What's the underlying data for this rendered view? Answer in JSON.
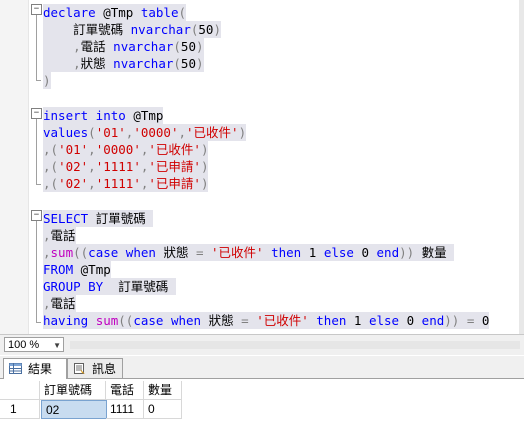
{
  "editor": {
    "lines": [
      [
        [
          "kw",
          "declare "
        ],
        [
          "id",
          "@Tmp "
        ],
        [
          "kw",
          "table"
        ],
        [
          "op",
          "("
        ]
      ],
      [
        [
          "id",
          "    訂單號碼 "
        ],
        [
          "kw",
          "nvarchar"
        ],
        [
          "op",
          "("
        ],
        [
          "lit",
          "50"
        ],
        [
          "op",
          ")"
        ]
      ],
      [
        [
          "op",
          "    ,"
        ],
        [
          "id",
          "電話 "
        ],
        [
          "kw",
          "nvarchar"
        ],
        [
          "op",
          "("
        ],
        [
          "lit",
          "50"
        ],
        [
          "op",
          ")"
        ]
      ],
      [
        [
          "op",
          "    ,"
        ],
        [
          "id",
          "狀態 "
        ],
        [
          "kw",
          "nvarchar"
        ],
        [
          "op",
          "("
        ],
        [
          "lit",
          "50"
        ],
        [
          "op",
          ")"
        ]
      ],
      [
        [
          "op",
          ")"
        ]
      ],
      [],
      [
        [
          "kw",
          "insert into "
        ],
        [
          "id",
          "@Tmp"
        ]
      ],
      [
        [
          "kw",
          "values"
        ],
        [
          "op",
          "("
        ],
        [
          "str",
          "'01'"
        ],
        [
          "op",
          ","
        ],
        [
          "str",
          "'0000'"
        ],
        [
          "op",
          ","
        ],
        [
          "str",
          "'已收件'"
        ],
        [
          "op",
          ")"
        ]
      ],
      [
        [
          "op",
          ",("
        ],
        [
          "str",
          "'01'"
        ],
        [
          "op",
          ","
        ],
        [
          "str",
          "'0000'"
        ],
        [
          "op",
          ","
        ],
        [
          "str",
          "'已收件'"
        ],
        [
          "op",
          ")"
        ]
      ],
      [
        [
          "op",
          ",("
        ],
        [
          "str",
          "'02'"
        ],
        [
          "op",
          ","
        ],
        [
          "str",
          "'1111'"
        ],
        [
          "op",
          ","
        ],
        [
          "str",
          "'已申請'"
        ],
        [
          "op",
          ")"
        ]
      ],
      [
        [
          "op",
          ",("
        ],
        [
          "str",
          "'02'"
        ],
        [
          "op",
          ","
        ],
        [
          "str",
          "'1111'"
        ],
        [
          "op",
          ","
        ],
        [
          "str",
          "'已申請'"
        ],
        [
          "op",
          ")"
        ]
      ],
      [],
      [
        [
          "kw",
          "SELECT "
        ],
        [
          "id",
          "訂單號碼 "
        ]
      ],
      [
        [
          "op",
          ","
        ],
        [
          "id",
          "電話"
        ]
      ],
      [
        [
          "op",
          ","
        ],
        [
          "fn",
          "sum"
        ],
        [
          "op",
          "(("
        ],
        [
          "kw",
          "case when "
        ],
        [
          "id",
          "狀態 "
        ],
        [
          "op",
          "= "
        ],
        [
          "str",
          "'已收件' "
        ],
        [
          "kw",
          "then "
        ],
        [
          "lit",
          "1 "
        ],
        [
          "kw",
          "else "
        ],
        [
          "lit",
          "0 "
        ],
        [
          "kw",
          "end"
        ],
        [
          "op",
          "))"
        ],
        [
          "id",
          " 數量 "
        ]
      ],
      [
        [
          "kw",
          "FROM "
        ],
        [
          "id",
          "@Tmp"
        ]
      ],
      [
        [
          "kw",
          "GROUP BY  "
        ],
        [
          "id",
          "訂單號碼 "
        ]
      ],
      [
        [
          "op",
          ","
        ],
        [
          "id",
          "電話"
        ]
      ],
      [
        [
          "kw",
          "having "
        ],
        [
          "fn",
          "sum"
        ],
        [
          "op",
          "(("
        ],
        [
          "kw",
          "case when "
        ],
        [
          "id",
          "狀態 "
        ],
        [
          "op",
          "= "
        ],
        [
          "str",
          "'已收件' "
        ],
        [
          "kw",
          "then "
        ],
        [
          "lit",
          "1 "
        ],
        [
          "kw",
          "else "
        ],
        [
          "lit",
          "0 "
        ],
        [
          "kw",
          "end"
        ],
        [
          "op",
          ")) = "
        ],
        [
          "lit",
          "0"
        ]
      ]
    ]
  },
  "status": {
    "zoom": "100 %"
  },
  "tabs": {
    "results": "結果",
    "messages": "訊息"
  },
  "results": {
    "columns": [
      "訂單號碼",
      "電話",
      "數量"
    ],
    "rows": [
      {
        "num": "1",
        "cells": [
          "02",
          "1111",
          "0"
        ]
      }
    ]
  },
  "colors": {
    "keyword": "#0000ff",
    "string": "#d00000",
    "operator": "#808080",
    "function": "#c000c0",
    "selection": "#c8dcf0"
  }
}
